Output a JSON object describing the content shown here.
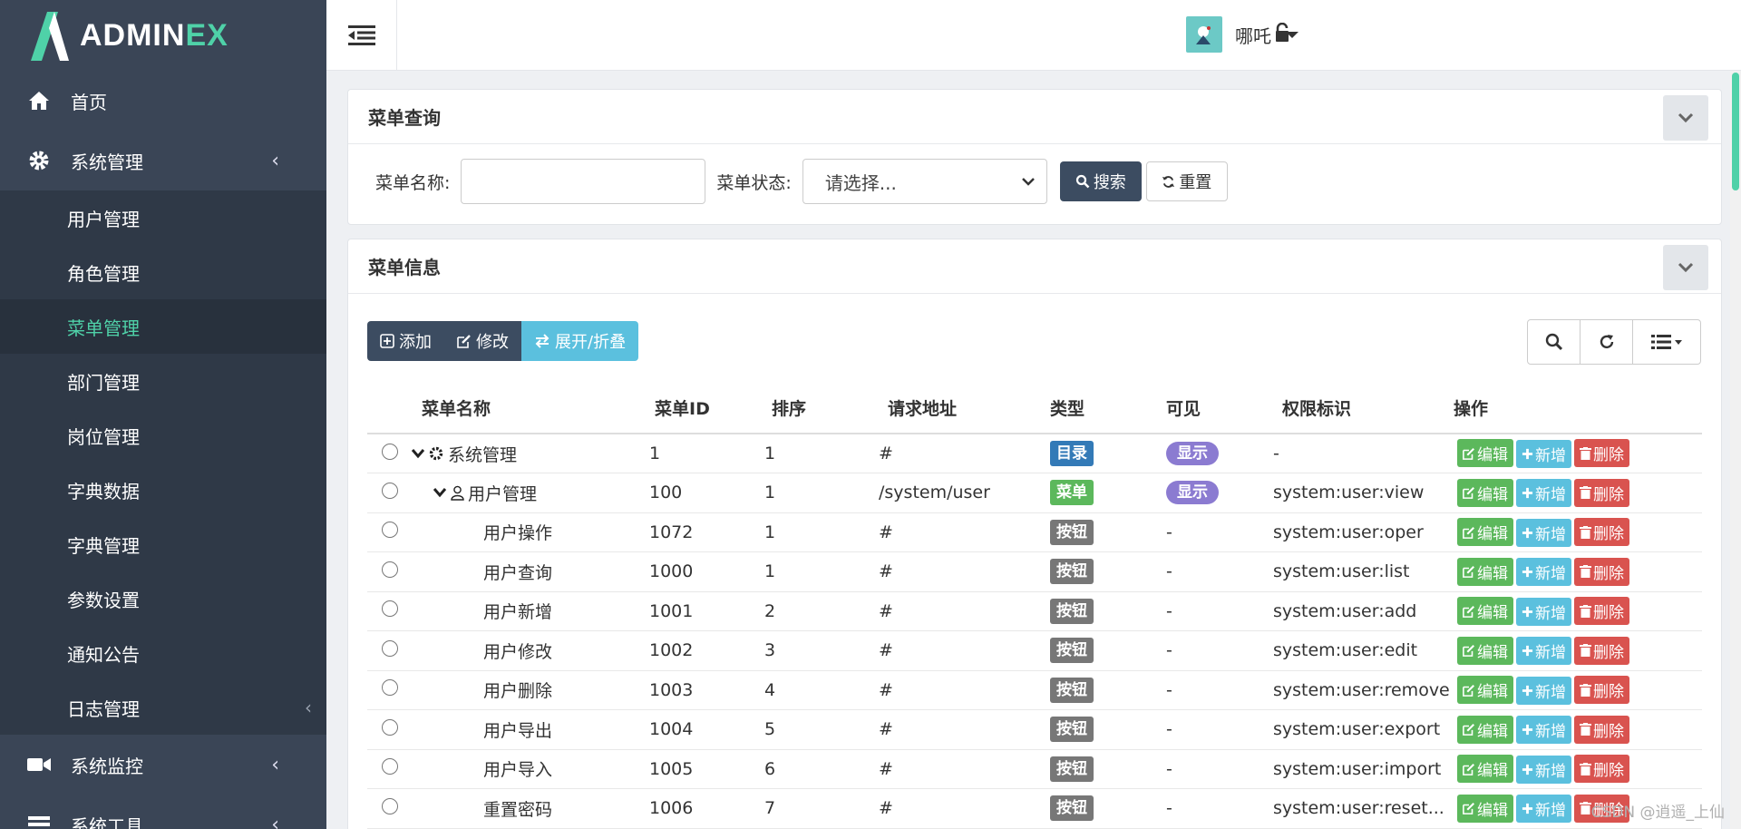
{
  "brand": {
    "name_main": "ADMIN",
    "name_accent": "EX"
  },
  "sidebar": {
    "home": "首页",
    "system": "系统管理",
    "submenu": [
      "用户管理",
      "角色管理",
      "菜单管理",
      "部门管理",
      "岗位管理",
      "字典数据",
      "字典管理",
      "参数设置",
      "通知公告",
      "日志管理"
    ],
    "active": "菜单管理",
    "monitor": "系统监控",
    "tools": "系统工具"
  },
  "header": {
    "user": "哪吒"
  },
  "query_panel": {
    "title": "菜单查询",
    "name_label": "菜单名称:",
    "name_value": "",
    "status_label": "菜单状态:",
    "status_value": "请选择...",
    "search_btn": "搜索",
    "reset_btn": "重置"
  },
  "info_panel": {
    "title": "菜单信息",
    "add_btn": "添加",
    "edit_btn": "修改",
    "expand_btn": "展开/折叠"
  },
  "table": {
    "columns": [
      "菜单名称",
      "菜单ID",
      "排序",
      "请求地址",
      "类型",
      "可见",
      "权限标识",
      "操作"
    ],
    "actions": {
      "edit": "编辑",
      "add": "新增",
      "del": "删除"
    },
    "rows": [
      {
        "name": "系统管理",
        "id": "1",
        "order": "1",
        "url": "#",
        "type": "目录",
        "visible": "显示",
        "perm": "-"
      },
      {
        "name": "用户管理",
        "id": "100",
        "order": "1",
        "url": "/system/user",
        "type": "菜单",
        "visible": "显示",
        "perm": "system:user:view"
      },
      {
        "name": "用户操作",
        "id": "1072",
        "order": "1",
        "url": "#",
        "type": "按钮",
        "visible": "-",
        "perm": "system:user:oper"
      },
      {
        "name": "用户查询",
        "id": "1000",
        "order": "1",
        "url": "#",
        "type": "按钮",
        "visible": "-",
        "perm": "system:user:list"
      },
      {
        "name": "用户新增",
        "id": "1001",
        "order": "2",
        "url": "#",
        "type": "按钮",
        "visible": "-",
        "perm": "system:user:add"
      },
      {
        "name": "用户修改",
        "id": "1002",
        "order": "3",
        "url": "#",
        "type": "按钮",
        "visible": "-",
        "perm": "system:user:edit"
      },
      {
        "name": "用户删除",
        "id": "1003",
        "order": "4",
        "url": "#",
        "type": "按钮",
        "visible": "-",
        "perm": "system:user:remove"
      },
      {
        "name": "用户导出",
        "id": "1004",
        "order": "5",
        "url": "#",
        "type": "按钮",
        "visible": "-",
        "perm": "system:user:export"
      },
      {
        "name": "用户导入",
        "id": "1005",
        "order": "6",
        "url": "#",
        "type": "按钮",
        "visible": "-",
        "perm": "system:user:import"
      },
      {
        "name": "重置密码",
        "id": "1006",
        "order": "7",
        "url": "#",
        "type": "按钮",
        "visible": "-",
        "perm": "system:user:reset..."
      }
    ]
  },
  "colors": {
    "sidebar_bg": "#3a4556",
    "accent": "#4fd1a8",
    "type_dir": "#337ab7",
    "type_menu": "#5cb85c",
    "type_btn": "#777777",
    "visible": "#8b7bd1"
  },
  "watermark": "CSDN @逍遥_上仙"
}
